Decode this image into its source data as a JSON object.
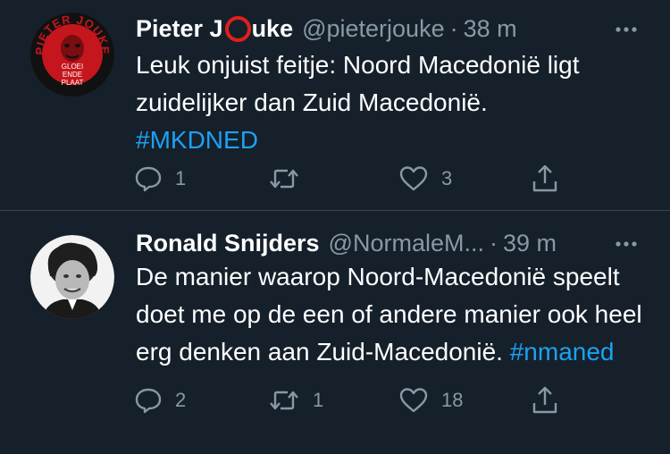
{
  "tweets": [
    {
      "name_part1": "Pieter J",
      "name_part2": "uke",
      "handle": "@pieterjouke",
      "sep": "·",
      "time": "38 m",
      "text": "Leuk onjuist feitje: Noord Macedonië ligt zuidelijker dan Zuid Macedonië.",
      "hashtag": "#MKDNED",
      "avatar": {
        "ring_text": "PIETER JOUKE",
        "center_text": [
          "GLOEI",
          "ENDE",
          "PLAAT"
        ],
        "bg_color": "#c4161c",
        "ring_color": "#111111"
      },
      "reply_count": "1",
      "retweet_count": "",
      "like_count": "3"
    },
    {
      "name": "Ronald Snijders",
      "handle": "@NormaleM...",
      "sep": "·",
      "time": "39 m",
      "text": "De manier waarop Noord-Macedonië speelt doet me op de een of andere manier ook heel erg denken aan Zuid-Macedonië.",
      "hashtag": "#nmaned",
      "reply_count": "2",
      "retweet_count": "1",
      "like_count": "18"
    }
  ],
  "icons": {
    "more": "more-horizontal-icon",
    "reply": "reply-icon",
    "retweet": "retweet-icon",
    "like": "heart-icon",
    "share": "share-icon"
  },
  "colors": {
    "background": "#15202b",
    "text": "#ffffff",
    "secondary": "#8899a6",
    "link": "#1da1f2",
    "divider": "#38444d"
  }
}
